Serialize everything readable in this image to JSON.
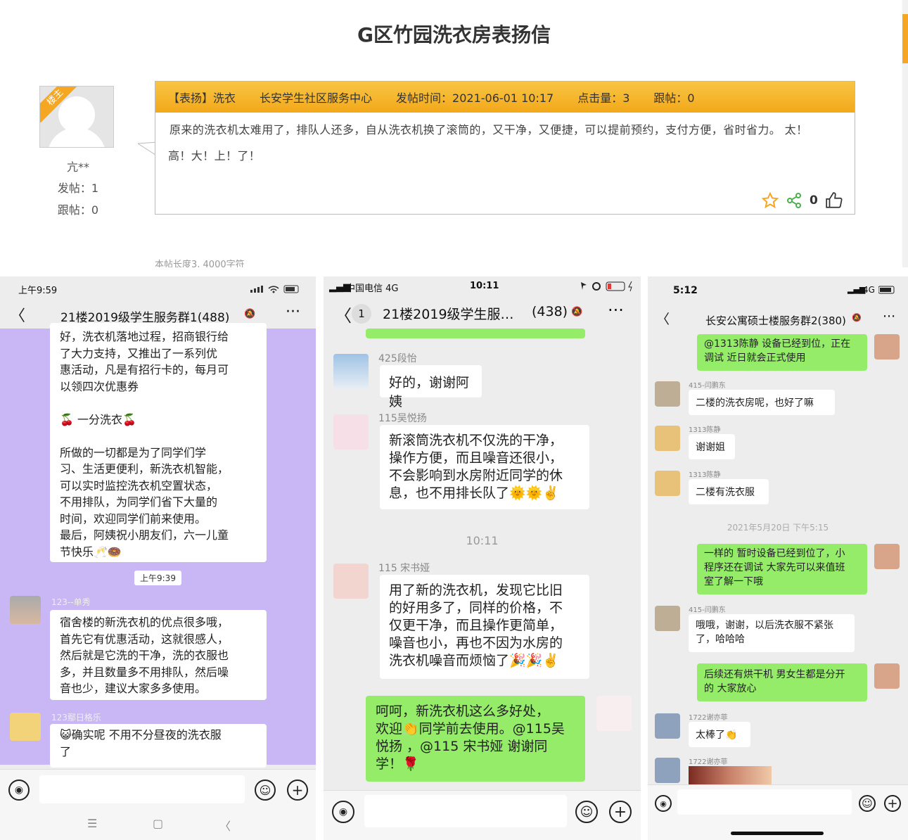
{
  "forum": {
    "title": "G区竹园洗衣房表扬信",
    "badge": "楼主",
    "user_name": "亢**",
    "user_posts": "发帖：1",
    "user_follow": "跟帖：0",
    "header": {
      "category": "【表扬】洗衣",
      "org": "长安学生社区服务中心",
      "time": "发帖时间：2021-06-01 10:17",
      "clicks": "点击量：3",
      "replies": "跟帖：0"
    },
    "body_line1": "原来的洗衣机太难用了，排队人还多，自从洗衣机换了滚筒的，又干净，又便捷，可以提前预约，支付方便，省时省力。 太！",
    "body_line2": "高！大！上！了！",
    "like_count": "0",
    "cut_text": "本帖长度3, 4000字符",
    "icons": [
      "star-icon",
      "share-icon",
      "thumbs-up-icon"
    ],
    "accent_color": "#f5a623"
  },
  "phone1": {
    "time": "上午9:59",
    "title": "21楼2019级学生服务群1(488)",
    "messages": [
      {
        "text_lines": [
          "好，洗衣机落地过程，招商银行给",
          "了大力支持，又推出了一系列优",
          "惠活动，凡是有招行卡的，每月可",
          "以领四次优惠券",
          "",
          "🍒 一分洗衣🍒",
          "",
          "所做的一切都是为了同学们学",
          "习、生活更便利，新洗衣机智能，",
          "可以实时监控洗衣机空置状态，",
          "不用排队，为同学们省下大量的",
          "时间，欢迎同学们前来使用。",
          "最后，阿姨祝小朋友们，六一儿童",
          "节快乐🥂🍩"
        ]
      },
      {
        "time": "上午9:39"
      },
      {
        "name": "123--单秀",
        "text_lines": [
          "宿舍楼的新洗衣机的优点很多哦，",
          "首先它有优惠活动，这就很感人，",
          "然后就是它洗的干净，洗的衣服也",
          "多，并且数量多不用排队，然后噪",
          "音也少，建议大家多多使用。"
        ]
      },
      {
        "name": "123鄢日格乐",
        "text_lines": [
          "😺确实呢 不用不分昼夜的洗衣服",
          "了"
        ]
      }
    ],
    "nav": [
      "☰",
      "▢",
      "〈"
    ]
  },
  "phone2": {
    "carrier": "中国电信  4G",
    "time": "10:11",
    "badge": "1",
    "title": "21楼2019级学生服…",
    "count": "(438)",
    "messages": [
      {
        "name": "425段怡",
        "text": "好的，谢谢阿姨"
      },
      {
        "name": "115吴悦扬",
        "text_lines": [
          "新滚筒洗衣机不仅洗的干净，",
          "操作方便，而且噪音还很小，",
          "不会影响到水房附近同学的休",
          "息，也不用排长队了🌞🌞✌️"
        ]
      },
      {
        "time": "10:11"
      },
      {
        "name": "115  宋书娅",
        "text_lines": [
          "用了新的洗衣机，发现它比旧",
          "的好用多了，同样的价格，不",
          "仅更干净，而且操作更简单，",
          "噪音也小，再也不因为水房的",
          "洗衣机噪音而烦恼了🎉🎉✌️"
        ]
      },
      {
        "self": true,
        "text_lines": [
          "呵呵，新洗衣机这么多好处，",
          "欢迎👏同学前去使用。@115吴",
          "悦扬 ，@115  宋书娅 谢谢同",
          "学！🌹"
        ]
      }
    ]
  },
  "phone3": {
    "time": "5:12",
    "signal": "4G",
    "title": "长安公寓硕士楼服务群2(380)",
    "messages": [
      {
        "self": true,
        "text_lines": [
          "@1313陈静 设备已经到位，正在",
          "调试 近日就会正式使用"
        ]
      },
      {
        "name": "415-闫鹏东",
        "text": "二楼的洗衣房呢，也好了嘛"
      },
      {
        "name": "1313陈静",
        "text": "谢谢姐"
      },
      {
        "name": "1313陈静",
        "text": "二楼有洗衣服"
      },
      {
        "time": "2021年5月20日 下午5:15"
      },
      {
        "self": true,
        "text_lines": [
          "一样的 暂时设备已经到位了，小",
          "程序还在调试 大家先可以来值班",
          "室了解一下哦"
        ]
      },
      {
        "name": "415-闫鹏东",
        "text_lines": [
          "哦哦，谢谢，以后洗衣服不紧张",
          "了，哈哈哈"
        ]
      },
      {
        "self": true,
        "text_lines": [
          "后续还有烘干机 男女生都是分开",
          "的 大家放心"
        ]
      },
      {
        "name": "1722谢亦菲",
        "text": "太棒了👏"
      },
      {
        "name": "1722谢亦菲"
      }
    ]
  }
}
